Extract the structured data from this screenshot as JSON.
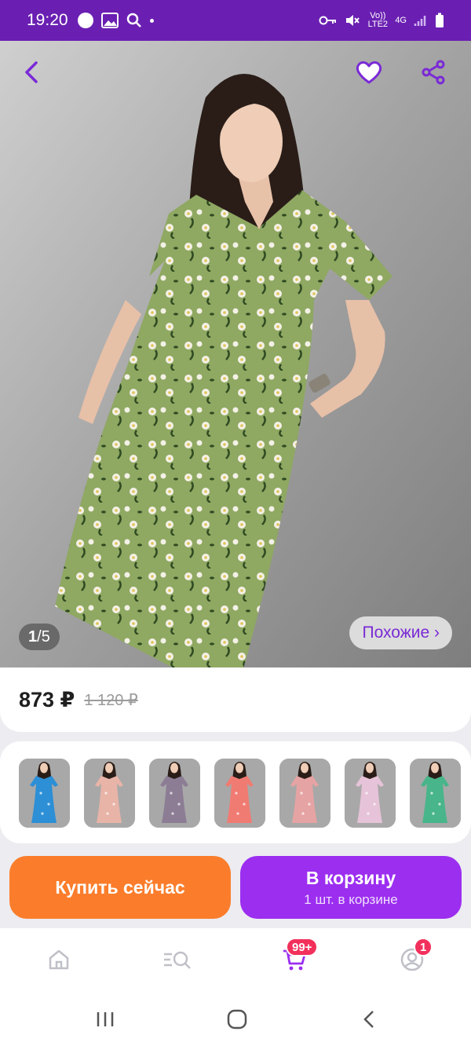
{
  "status": {
    "time": "19:20",
    "lte_label": "Vo)) LTE2",
    "net_label": "4G"
  },
  "photo": {
    "counter_current": "1",
    "counter_sep": "/",
    "counter_total": "5",
    "similar_label": "Похожие ›"
  },
  "price": {
    "current": "873 ₽",
    "old": "1 120 ₽"
  },
  "thumbnails": {
    "colors": [
      "#2d8fd6",
      "#e8b4a8",
      "#8c7d95",
      "#f07b72",
      "#e6a3a3",
      "#e6c3d8",
      "#48b58a"
    ]
  },
  "actions": {
    "buy_label": "Купить сейчас",
    "cart_label": "В корзину",
    "cart_sub": "1 шт. в корзине"
  },
  "tabbar": {
    "cart_badge": "99+",
    "profile_badge": "1"
  },
  "colors": {
    "accent": "#6a1fb2",
    "buy": "#fb7d2b",
    "cart": "#9c2ef0",
    "badge": "#f2305b",
    "dress": "#8fa862"
  }
}
